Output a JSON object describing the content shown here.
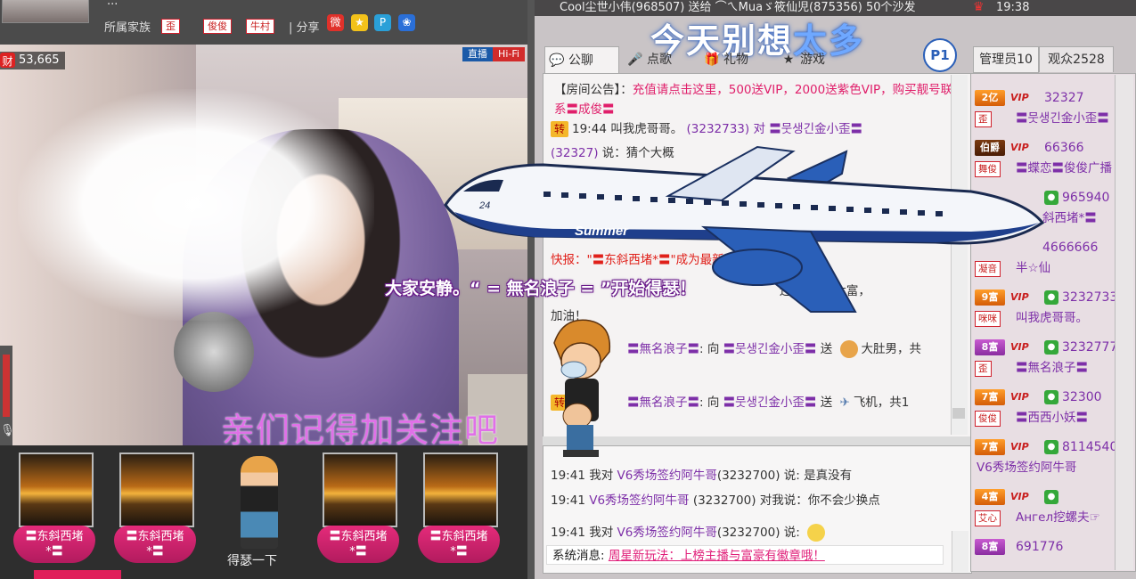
{
  "anchor": {
    "name": "...",
    "family_label": "所属家族",
    "family_badges": [
      "歪",
      "俊俊",
      "牛村"
    ],
    "share_label": "| 分享",
    "wealth_icon": "财",
    "wealth": "53,665",
    "live_label": "直播",
    "hifi_label": "Hi-Fi",
    "video_caption": "亲们记得加关注吧"
  },
  "gifts": [
    {
      "label": "〓东斜西堵\n*〓"
    },
    {
      "label": "〓东斜西堵\n*〓"
    },
    {
      "label": "〓东斜西堵\n*〓"
    },
    {
      "label": "〓东斜西堵\n*〓"
    }
  ],
  "figure_label": "得瑟一下",
  "topbar": {
    "text": "Cool尘世小伟(968507) 送给 ⌒ㄟMuaゞ筱仙児(875356) 50个沙发",
    "time": "19:38"
  },
  "big_title": {
    "before": "今天别想",
    "highlight": "太多"
  },
  "p1": "P1",
  "chat_tabs": [
    "公聊",
    "点歌",
    "礼物",
    "游戏"
  ],
  "announcement": {
    "label": "【房间公告】：",
    "text": "充值请点击这里，500送VIP，2000送紫色VIP，购买靓号联系〓成俊〓"
  },
  "chat": {
    "line1_time": "19:44 叫我虎哥哥。",
    "line1_id": "(3232733)",
    "line1_rest": " 对 〓뭇생긴金小歪〓",
    "line2_id": "(32327)",
    "line2_text": " 说：猜个大概",
    "flash_prefix": "快报：\"〓东斜西堵*〓\"成为最新",
    "flash_rest": "还差9953六富，",
    "cheer": "加油！",
    "gift1_user": "〓無名浪子〓",
    "gift1_mid": ": 向 ",
    "gift1_target": "〓뭇생긴金小歪〓",
    "gift1_send": " 送 ",
    "gift1_item": "大肚男，共",
    "gift2_badge": "转",
    "gift2_user": "〓無名浪子〓",
    "gift2_mid": ": 向 ",
    "gift2_target": "〓뭇생긴金小歪〓",
    "gift2_send": " 送 ",
    "gift2_item": "飞机，共1"
  },
  "private": {
    "l1_prefix": "19:41 我对 ",
    "l1_user": "V6秀场签约阿牛哥",
    "l1_rest": "(3232700) 说: 是真没有",
    "l2_prefix": "19:41 ",
    "l2_user": "V6秀场签约阿牛哥",
    "l2_rest": " (3232700) 对我说：你不会少换点",
    "l3_prefix": "19:41 我对 ",
    "l3_user": "V6秀场签约阿牛哥",
    "l3_rest": "(3232700) 说:",
    "sys_label": "系统消息: ",
    "sys_link": "周星新玩法：上榜主播与富豪有徽章哦！"
  },
  "audience_tabs": {
    "admin": "管理员10",
    "viewers": "观众2528"
  },
  "audience": [
    {
      "level": "2亿",
      "uid": "32327",
      "fam": "歪",
      "name": "〓뭇생긴金小歪〓"
    },
    {
      "level": "伯爵",
      "uid": "66366",
      "fam": "舞俊",
      "name": "〓蝶恋〓俊俊广播"
    },
    {
      "level": "",
      "uid": "965940",
      "fam": "",
      "name": "斜西堵*〓"
    },
    {
      "level": "",
      "uid": "4666666",
      "fam": "凝音",
      "name": "半☆仙"
    },
    {
      "level": "9富",
      "uid": "3232733",
      "fam": "咪咪",
      "name": "叫我虎哥哥。"
    },
    {
      "level": "8富",
      "uid": "3232777",
      "fam": "歪",
      "name": "〓無名浪子〓"
    },
    {
      "level": "7富",
      "uid": "32300",
      "fam": "俊俊",
      "name": "〓西西小妖〓"
    },
    {
      "level": "7富",
      "uid": "8114540",
      "fam": "",
      "name": "V6秀场签约阿牛哥"
    },
    {
      "level": "4富",
      "uid": "",
      "fam": "艾心",
      "name": "Ангел挖螺夫☞"
    },
    {
      "level": "8富",
      "uid": "691776",
      "fam": "",
      "name": ""
    }
  ],
  "vip_label": "VIP",
  "overlay_shout": "大家安静。“ = 無名浪子 = ”开始得瑟！",
  "plane_label": "Summer",
  "plane_number": "24",
  "colors": {
    "accent_pink": "#e01e5a",
    "chat_purple": "#7d2fa8",
    "chat_red": "#e0201a",
    "title_blue": "#6fa8ff"
  }
}
